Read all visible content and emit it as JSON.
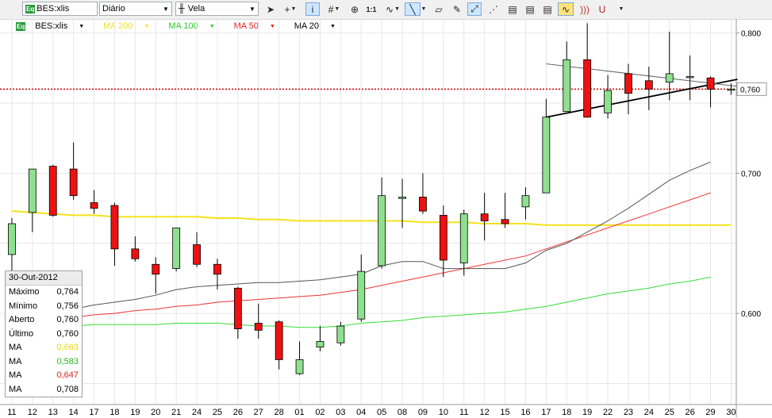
{
  "toolbar": {
    "symbol": "BES:xlis",
    "symbol_badge": "Eq",
    "period": "Diário",
    "chart_type_label": "Vela",
    "icons": [
      "cursor-icon",
      "crosshair-icon",
      "info-icon",
      "grid-icon",
      "zoom-icon",
      "one-to-one-icon",
      "wave-icon",
      "line-tool-icon",
      "eraser-icon",
      "draw-icon",
      "trend-icon",
      "pattern-icon",
      "alert-icon",
      "overlay-icon",
      "indicator-icon",
      "signal-icon",
      "magnet-icon",
      "more-icon"
    ],
    "one_to_one": "1:1"
  },
  "legend": [
    {
      "label": "BES:xlis",
      "color": "#000000",
      "badge": "Eq"
    },
    {
      "label": "MA 200",
      "color": "#f4e21c"
    },
    {
      "label": "MA 100",
      "color": "#22cc22"
    },
    {
      "label": "MA 50",
      "color": "#e02020"
    },
    {
      "label": "MA 20",
      "color": "#000000"
    }
  ],
  "price_label": "0,760",
  "infobox": {
    "date": "30-Out-2012",
    "rows": [
      {
        "label": "Máximo",
        "value": "0,764",
        "color": "#000000"
      },
      {
        "label": "Mínimo",
        "value": "0,756",
        "color": "#000000"
      },
      {
        "label": "Aberto",
        "value": "0,760",
        "color": "#000000"
      },
      {
        "label": "Último",
        "value": "0,760",
        "color": "#000000"
      },
      {
        "label": "MA",
        "value": "0,663",
        "color": "#e8d800"
      },
      {
        "label": "MA",
        "value": "0,583",
        "color": "#22bb22"
      },
      {
        "label": "MA",
        "value": "0,647",
        "color": "#e02020"
      },
      {
        "label": "MA",
        "value": "0,708",
        "color": "#000000"
      }
    ]
  },
  "colors": {
    "up": "#8ee08e",
    "down": "#ee1111",
    "ma200": "#f4e21c",
    "ma100": "#33dd33",
    "ma50": "#ee3333",
    "ma20": "#555555",
    "price_line": "#cc0000"
  },
  "chart_data": {
    "type": "candlestick",
    "x": [
      "11",
      "12",
      "13",
      "14",
      "17",
      "18",
      "19",
      "20",
      "21",
      "24",
      "25",
      "26",
      "27",
      "28",
      "01",
      "02",
      "03",
      "04",
      "05",
      "08",
      "09",
      "10",
      "11",
      "12",
      "15",
      "16",
      "17",
      "18",
      "19",
      "22",
      "23",
      "24",
      "25",
      "26",
      "29",
      "30"
    ],
    "y_ticks": [
      "0,800",
      "0,700",
      "0,600"
    ],
    "ylim": [
      0.535,
      0.81
    ],
    "candles": [
      {
        "o": 0.642,
        "h": 0.668,
        "l": 0.626,
        "c": 0.664
      },
      {
        "o": 0.672,
        "h": 0.703,
        "l": 0.658,
        "c": 0.703
      },
      {
        "o": 0.705,
        "h": 0.706,
        "l": 0.669,
        "c": 0.67
      },
      {
        "o": 0.703,
        "h": 0.722,
        "l": 0.681,
        "c": 0.684
      },
      {
        "o": 0.679,
        "h": 0.688,
        "l": 0.671,
        "c": 0.675
      },
      {
        "o": 0.677,
        "h": 0.679,
        "l": 0.634,
        "c": 0.646
      },
      {
        "o": 0.646,
        "h": 0.655,
        "l": 0.637,
        "c": 0.639
      },
      {
        "o": 0.635,
        "h": 0.64,
        "l": 0.614,
        "c": 0.628
      },
      {
        "o": 0.632,
        "h": 0.661,
        "l": 0.63,
        "c": 0.661
      },
      {
        "o": 0.649,
        "h": 0.658,
        "l": 0.633,
        "c": 0.635
      },
      {
        "o": 0.635,
        "h": 0.639,
        "l": 0.617,
        "c": 0.628
      },
      {
        "o": 0.618,
        "h": 0.619,
        "l": 0.582,
        "c": 0.589
      },
      {
        "o": 0.593,
        "h": 0.607,
        "l": 0.582,
        "c": 0.588
      },
      {
        "o": 0.594,
        "h": 0.595,
        "l": 0.56,
        "c": 0.567
      },
      {
        "o": 0.557,
        "h": 0.58,
        "l": 0.556,
        "c": 0.567
      },
      {
        "o": 0.576,
        "h": 0.591,
        "l": 0.573,
        "c": 0.58
      },
      {
        "o": 0.579,
        "h": 0.594,
        "l": 0.577,
        "c": 0.591
      },
      {
        "o": 0.596,
        "h": 0.642,
        "l": 0.594,
        "c": 0.63
      },
      {
        "o": 0.634,
        "h": 0.697,
        "l": 0.632,
        "c": 0.684
      },
      {
        "o": 0.682,
        "h": 0.696,
        "l": 0.661,
        "c": 0.683
      },
      {
        "o": 0.683,
        "h": 0.7,
        "l": 0.671,
        "c": 0.673
      },
      {
        "o": 0.67,
        "h": 0.677,
        "l": 0.626,
        "c": 0.638
      },
      {
        "o": 0.636,
        "h": 0.674,
        "l": 0.627,
        "c": 0.671
      },
      {
        "o": 0.671,
        "h": 0.686,
        "l": 0.652,
        "c": 0.666
      },
      {
        "o": 0.667,
        "h": 0.686,
        "l": 0.661,
        "c": 0.664
      },
      {
        "o": 0.676,
        "h": 0.69,
        "l": 0.667,
        "c": 0.684
      },
      {
        "o": 0.686,
        "h": 0.753,
        "l": 0.686,
        "c": 0.74
      },
      {
        "o": 0.744,
        "h": 0.794,
        "l": 0.744,
        "c": 0.781
      },
      {
        "o": 0.781,
        "h": 0.807,
        "l": 0.741,
        "c": 0.74
      },
      {
        "o": 0.743,
        "h": 0.77,
        "l": 0.739,
        "c": 0.759
      },
      {
        "o": 0.771,
        "h": 0.778,
        "l": 0.742,
        "c": 0.757
      },
      {
        "o": 0.766,
        "h": 0.776,
        "l": 0.745,
        "c": 0.76
      },
      {
        "o": 0.765,
        "h": 0.801,
        "l": 0.752,
        "c": 0.771
      },
      {
        "o": 0.769,
        "h": 0.784,
        "l": 0.752,
        "c": 0.769
      },
      {
        "o": 0.768,
        "h": 0.769,
        "l": 0.747,
        "c": 0.76
      },
      {
        "o": 0.76,
        "h": 0.764,
        "l": 0.756,
        "c": 0.76
      }
    ],
    "series": [
      {
        "values": [
          0.673,
          0.672,
          0.671,
          0.67,
          0.67,
          0.669,
          0.669,
          0.669,
          0.669,
          0.669,
          0.668,
          0.668,
          0.667,
          0.667,
          0.666,
          0.666,
          0.666,
          0.666,
          0.666,
          0.666,
          0.665,
          0.665,
          0.665,
          0.664,
          0.664,
          0.664,
          0.663,
          0.663,
          0.663,
          0.663,
          0.663,
          0.663,
          0.663,
          0.663,
          0.663,
          0.663
        ]
      },
      {
        "values": [
          null,
          null,
          0.591,
          0.591,
          0.592,
          0.592,
          0.592,
          0.592,
          0.593,
          0.593,
          0.593,
          0.592,
          0.591,
          0.591,
          0.59,
          0.59,
          0.591,
          0.593,
          0.594,
          0.595,
          0.597,
          0.598,
          0.599,
          0.6,
          0.601,
          0.603,
          0.605,
          0.608,
          0.611,
          0.614,
          0.616,
          0.618,
          0.621,
          0.623,
          0.626,
          0.583
        ]
      },
      {
        "values": [
          null,
          null,
          0.596,
          0.597,
          0.599,
          0.6,
          0.602,
          0.603,
          0.605,
          0.606,
          0.608,
          0.609,
          0.61,
          0.611,
          0.612,
          0.613,
          0.615,
          0.617,
          0.62,
          0.623,
          0.626,
          0.629,
          0.632,
          0.635,
          0.638,
          0.641,
          0.646,
          0.651,
          0.656,
          0.661,
          0.666,
          0.671,
          0.676,
          0.681,
          0.686,
          0.647
        ]
      },
      {
        "values": [
          null,
          0.59,
          0.6,
          0.603,
          0.606,
          0.608,
          0.61,
          0.613,
          0.617,
          0.619,
          0.62,
          0.621,
          0.622,
          0.622,
          0.623,
          0.624,
          0.626,
          0.628,
          0.634,
          0.637,
          0.637,
          0.632,
          0.632,
          0.632,
          0.632,
          0.636,
          0.645,
          0.65,
          0.658,
          0.666,
          0.675,
          0.685,
          0.695,
          0.702,
          0.708,
          0.708
        ]
      }
    ],
    "trendlines": [
      {
        "x1": 26,
        "y1": 0.74,
        "x2": 35,
        "y2": 0.767
      },
      {
        "x1": 26,
        "y1": 0.778,
        "x2": 35,
        "y2": 0.762
      }
    ],
    "last_price": 0.76
  }
}
